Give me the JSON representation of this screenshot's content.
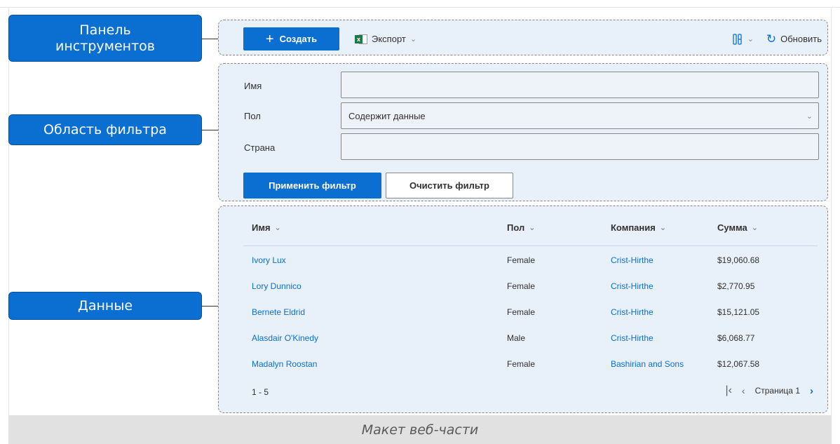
{
  "callouts": {
    "toolbar": "Панель\nинструментов",
    "filter": "Область фильтра",
    "data": "Данные"
  },
  "toolbar": {
    "create_label": "Создать",
    "export_label": "Экспорт",
    "refresh_label": "Обновить"
  },
  "filter": {
    "name_label": "Имя",
    "name_value": "",
    "sex_label": "Пол",
    "sex_value": "Содержит данные",
    "country_label": "Страна",
    "country_value": "",
    "apply_label": "Применить фильтр",
    "clear_label": "Очистить фильтр"
  },
  "grid": {
    "columns": [
      "Имя",
      "Пол",
      "Компания",
      "Сумма"
    ],
    "rows": [
      {
        "name": "Ivory Lux",
        "sex": "Female",
        "company": "Crist-Hirthe",
        "sum": "$19,060.68"
      },
      {
        "name": "Lory Dunnico",
        "sex": "Female",
        "company": "Crist-Hirthe",
        "sum": "$2,770.95"
      },
      {
        "name": "Bernete Eldrid",
        "sex": "Female",
        "company": "Crist-Hirthe",
        "sum": "$15,121.05"
      },
      {
        "name": "Alasdair O'Kinedy",
        "sex": "Male",
        "company": "Crist-Hirthe",
        "sum": "$6,068.77"
      },
      {
        "name": "Madalyn Roostan",
        "sex": "Female",
        "company": "Bashirian and Sons",
        "sum": "$12,067.58"
      }
    ]
  },
  "pager": {
    "range": "1 - 5",
    "page_label": "Страница 1"
  },
  "caption": "Макет веб-части",
  "colors": {
    "accent": "#0a6fd1",
    "region_bg": "#e8f0fa",
    "excel_green": "#1d7a45"
  },
  "icons": {
    "create": "plus-icon",
    "export": "excel-icon",
    "columns": "column-settings-icon",
    "refresh": "refresh-icon",
    "first": "first-page-icon",
    "prev": "prev-page-icon",
    "next": "next-page-icon"
  }
}
